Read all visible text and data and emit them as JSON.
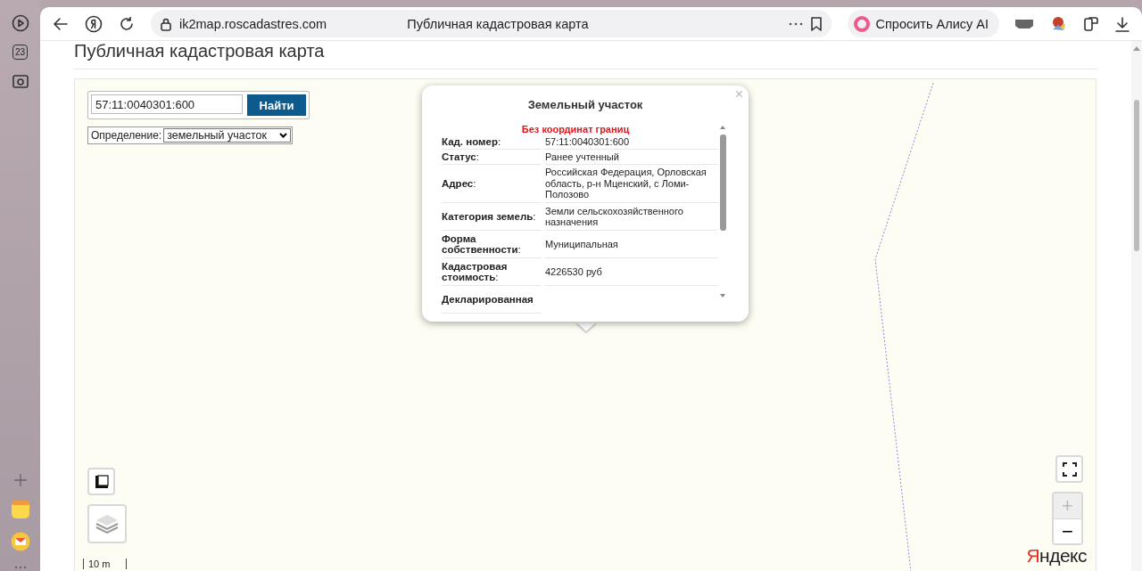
{
  "browser": {
    "sidebar_badge": "23",
    "url": "ik2map.roscadastres.com",
    "tab_title": "Публичная кадастровая карта",
    "assistant_button": "Спросить Алису AI"
  },
  "page": {
    "title": "Публичная кадастровая карта"
  },
  "search": {
    "value": "57:11:0040301:600",
    "button": "Найти",
    "filter_label": "Определение:",
    "filter_value": "земельный участок"
  },
  "popup": {
    "title": "Земельный участок",
    "close": "×",
    "notice": "Без координат границ",
    "rows": [
      {
        "label": "**Кад. номер**:",
        "value": "57:11:0040301:600"
      },
      {
        "label": "**Статус**:",
        "value": "Ранее учтенный"
      },
      {
        "label": "**Адрес**:",
        "value": "Российская Федерация, Орловская область, р-н Мценский, с Ломи-Полозово"
      },
      {
        "label": "**Категория земель**:",
        "value": "Земли сельскохозяйственного назначения"
      },
      {
        "label": "**Форма собственности**:",
        "value": "Муниципальная"
      },
      {
        "label": "**Кадастровая стоимость**:",
        "value": "4226530 руб"
      },
      {
        "label": "**Декларированная**"
      }
    ]
  },
  "zoom": [
    {
      "label": "+",
      "disabled": true
    },
    {
      "label": "−",
      "disabled": false
    }
  ],
  "scale": {
    "label": "10 m"
  },
  "map_logo": "Яндекс"
}
